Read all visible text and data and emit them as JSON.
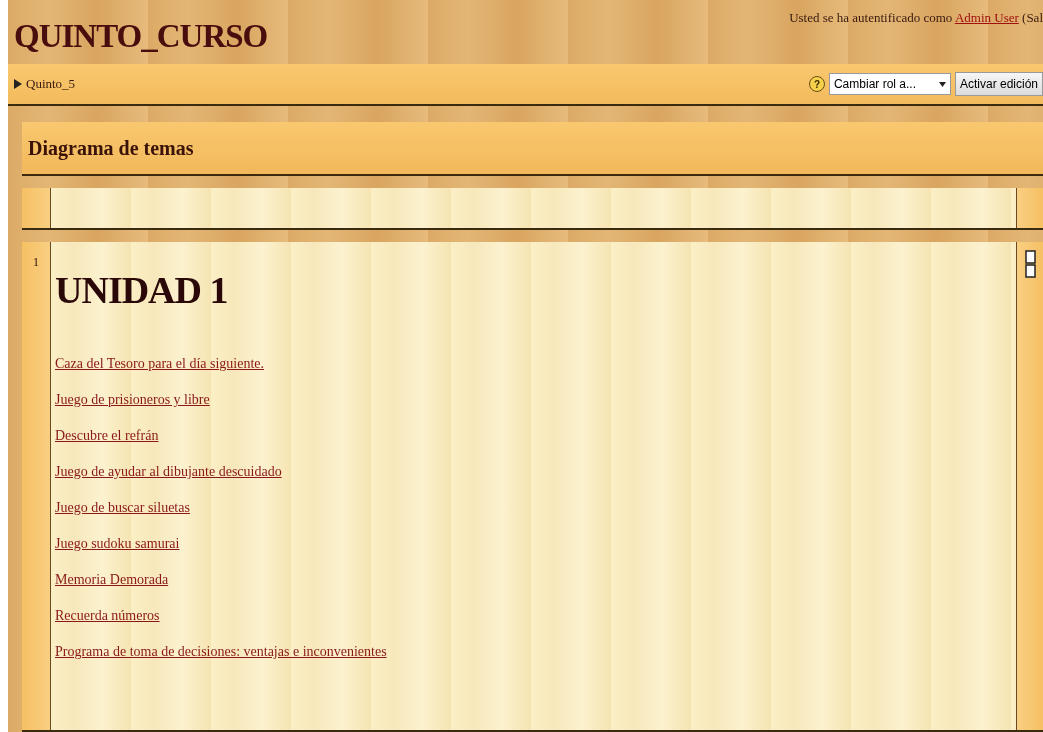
{
  "header": {
    "title": "QUINTO_CURSO",
    "login": {
      "prefix": "Usted se ha autentificado como ",
      "user_link": "Admin User",
      "suffix": " (Sal"
    }
  },
  "navbar": {
    "breadcrumb": "Quinto_5",
    "help": "?",
    "role_select": {
      "value": "Cambiar rol a..."
    },
    "edit_button": "Activar edición"
  },
  "block_title": "Diagrama de temas",
  "sections": [
    {
      "kind": "blank"
    },
    {
      "kind": "topic",
      "number": "1",
      "heading": "UNIDAD 1",
      "links": [
        "Caza del Tesoro para el día siguiente.",
        "Juego de prisioneros y libre",
        "Descubre el refrán",
        "Juego de ayudar al dibujante descuidado",
        "Juego de buscar siluetas",
        "Juego sudoku samurai",
        "Memoria Demorada",
        "Recuerda números",
        "Programa de toma de decisiones: ventajas e inconvenientes"
      ]
    }
  ]
}
